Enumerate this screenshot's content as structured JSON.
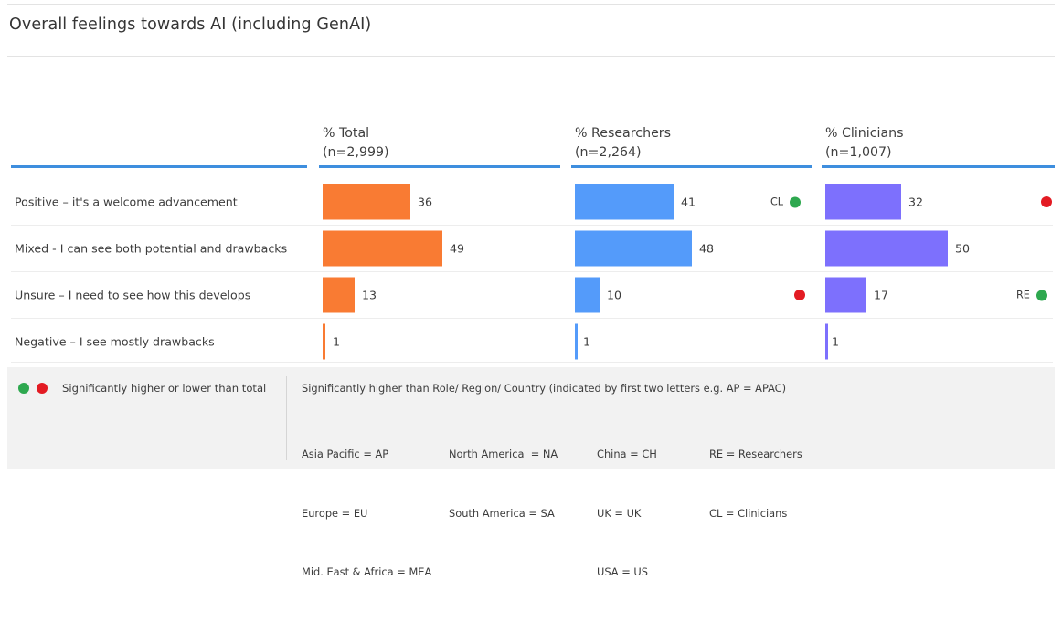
{
  "page_title": "Overall feelings towards AI (including GenAI)",
  "colors": {
    "total_bar": "#F97B33",
    "researchers_bar": "#549BFA",
    "clinicians_bar": "#7D70FD",
    "header_underline": "#3E8EDE",
    "higher_dot": "#2EA84F",
    "lower_dot": "#E31B23",
    "footer_bg": "#F2F2F2"
  },
  "columns": [
    {
      "title": "% Total",
      "subtitle": "(n=2,999)"
    },
    {
      "title": "% Researchers",
      "subtitle": "(n=2,264)"
    },
    {
      "title": "% Clinicians",
      "subtitle": "(n=1,007)"
    }
  ],
  "rows": [
    {
      "label": "Positive – it's a welcome advancement"
    },
    {
      "label": "Mixed - I can see both potential and drawbacks"
    },
    {
      "label": "Unsure – I need to see how this develops"
    },
    {
      "label": "Negative – I see mostly drawbacks"
    }
  ],
  "chart_data": {
    "type": "bar",
    "title": "Overall feelings towards AI (including GenAI)",
    "xlabel": "",
    "ylabel": "",
    "xlim": [
      0,
      60
    ],
    "grid": false,
    "legend": "none",
    "orientation": "horizontal",
    "categories": [
      "Positive – it's a welcome advancement",
      "Mixed - I can see both potential and drawbacks",
      "Unsure – I need to see how this develops",
      "Negative – I see mostly drawbacks"
    ],
    "series": [
      {
        "name": "% Total",
        "n": "2,999",
        "values": [
          36,
          49,
          13,
          1
        ]
      },
      {
        "name": "% Researchers",
        "n": "2,264",
        "values": [
          41,
          48,
          10,
          1
        ]
      },
      {
        "name": "% Clinicians",
        "n": "1,007",
        "values": [
          32,
          50,
          17,
          1
        ]
      }
    ],
    "annotations": [
      {
        "series": "% Researchers",
        "category": "Positive – it's a welcome advancement",
        "letters": "CL",
        "marker": "higher"
      },
      {
        "series": "% Researchers",
        "category": "Unsure – I need to see how this develops",
        "letters": "",
        "marker": "lower"
      },
      {
        "series": "% Clinicians",
        "category": "Positive – it's a welcome advancement",
        "letters": "",
        "marker": "lower"
      },
      {
        "series": "% Clinicians",
        "category": "Unsure – I need to see how this develops",
        "letters": "RE",
        "marker": "higher"
      }
    ]
  },
  "values": {
    "total": [
      "36",
      "49",
      "13",
      "1"
    ],
    "researchers": [
      "41",
      "48",
      "10",
      "1"
    ],
    "clinicians": [
      "32",
      "50",
      "17",
      "1"
    ]
  },
  "markers": {
    "researchers_r0_letters": "CL",
    "clinicians_r2_letters": "RE"
  },
  "footer": {
    "legend_text": "Significantly higher or lower than total",
    "note": "Significantly higher than Role/ Region/ Country (indicated by first two letters e.g. AP = APAC)",
    "abbr_col1": [
      "Asia Pacific = AP",
      "Europe = EU",
      "Mid. East & Africa = MEA"
    ],
    "abbr_col2": [
      "North America  = NA",
      "South America = SA"
    ],
    "abbr_col3": [
      "China = CH",
      "UK = UK",
      "USA = US"
    ],
    "abbr_col4": [
      "RE = Researchers",
      "CL = Clinicians"
    ]
  }
}
